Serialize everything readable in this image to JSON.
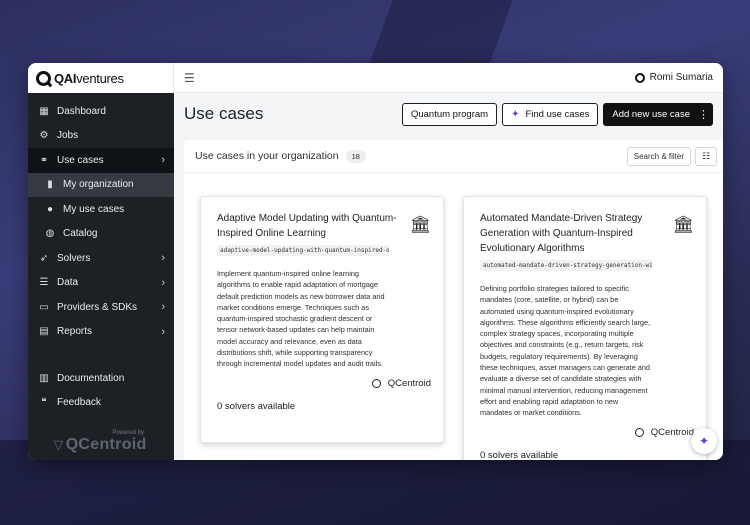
{
  "brand": {
    "logo_bold": "QAI",
    "logo_light": "ventures"
  },
  "sidebar": {
    "items": [
      {
        "label": "Dashboard",
        "icon": "dashboard-icon"
      },
      {
        "label": "Jobs",
        "icon": "gears-icon"
      },
      {
        "label": "Use cases",
        "icon": "sitemap-icon"
      },
      {
        "label": "My organization",
        "icon": "building-icon"
      },
      {
        "label": "My use cases",
        "icon": "user-circle-icon"
      },
      {
        "label": "Catalog",
        "icon": "globe-icon"
      },
      {
        "label": "Solvers",
        "icon": "rocket-icon"
      },
      {
        "label": "Data",
        "icon": "database-icon"
      },
      {
        "label": "Providers & SDKs",
        "icon": "server-icon"
      },
      {
        "label": "Reports",
        "icon": "file-icon"
      },
      {
        "label": "Documentation",
        "icon": "book-icon"
      },
      {
        "label": "Feedback",
        "icon": "comments-icon"
      }
    ],
    "powered_by": "Powered by",
    "footer_brand": "QCentroid"
  },
  "topbar": {
    "user_name": "Romi Sumaria"
  },
  "header": {
    "title": "Use cases",
    "btn_quantum": "Quantum program",
    "btn_find": "Find use cases",
    "btn_add": "Add new use case"
  },
  "panel": {
    "title": "Use cases in your organization",
    "count": "18",
    "filter_label": "Search & filter"
  },
  "cards": [
    {
      "title": "Adaptive Model Updating with Quantum-Inspired Online Learning",
      "slug": "adaptive-model-updating-with-quantum-inspired-onli",
      "description": "Implement quantum-inspired online learning algorithms to enable rapid adaptation of mortgage default prediction models as new borrower data and market conditions emerge. Techniques such as quantum-inspired stochastic gradient descent or tensor network-based updates can help maintain model accuracy and relevance, even as data distributions shift, while supporting transparency through incremental model updates and audit trails.",
      "owner": "QCentroid",
      "solvers": "0 solvers available"
    },
    {
      "title": "Automated Mandate-Driven Strategy Generation with Quantum-Inspired Evolutionary Algorithms",
      "slug": "automated-mandate-driven-strategy-generation-with-q",
      "description": "Defining portfolio strategies tailored to specific mandates (core, satellite, or hybrid) can be automated using quantum-inspired evolutionary algorithms. These algorithms efficiently search large, complex strategy spaces, incorporating multiple objectives and constraints (e.g., return targets, risk budgets, regulatory requirements). By leveraging these techniques, asset managers can generate and evaluate a diverse set of candidate strategies with minimal manual intervention, reducing management effort and enabling rapid adaptation to new mandates or market conditions.",
      "owner": "QCentroid",
      "solvers": "0 solvers available"
    }
  ]
}
